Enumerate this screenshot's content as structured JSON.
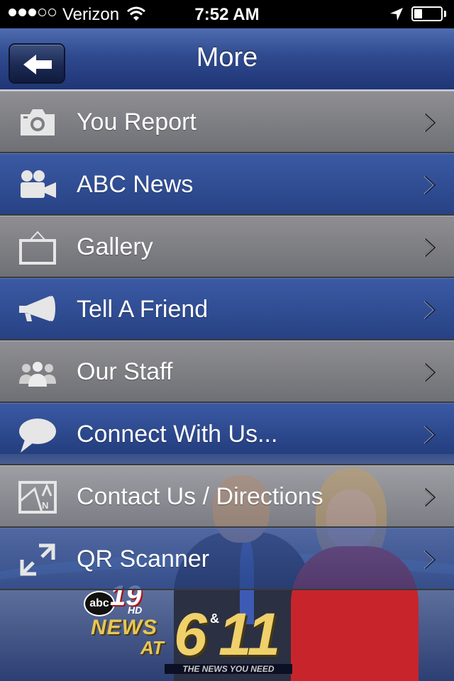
{
  "status_bar": {
    "carrier": "Verizon",
    "time": "7:52 AM",
    "signal_bars": 3,
    "signal_total": 5,
    "battery_level": 0.3
  },
  "nav": {
    "title": "More",
    "back_icon": "arrow-left-icon"
  },
  "menu": [
    {
      "label": "You Report",
      "icon": "camera-icon",
      "style": "gray"
    },
    {
      "label": "ABC News",
      "icon": "video-camera-icon",
      "style": "blue"
    },
    {
      "label": "Gallery",
      "icon": "picture-frame-icon",
      "style": "gray"
    },
    {
      "label": "Tell A Friend",
      "icon": "megaphone-icon",
      "style": "blue"
    },
    {
      "label": "Our Staff",
      "icon": "people-icon",
      "style": "gray"
    },
    {
      "label": "Connect With Us...",
      "icon": "speech-bubble-icon",
      "style": "blue"
    },
    {
      "label": "Contact Us / Directions",
      "icon": "map-icon",
      "style": "gray"
    },
    {
      "label": "QR Scanner",
      "icon": "expand-arrows-icon",
      "style": "blue"
    }
  ],
  "promo": {
    "logo_network": "abc",
    "logo_channel": "19",
    "logo_hd": "HD",
    "logo_news": "NEWS",
    "logo_at": "AT",
    "logo_six": "6",
    "logo_amp": "&",
    "logo_eleven": "11",
    "tagline": "THE NEWS YOU NEED"
  },
  "colors": {
    "nav_blue": "#2f4a8e",
    "row_blue": "#3b5aa4",
    "row_gray": "#8e8e93"
  }
}
